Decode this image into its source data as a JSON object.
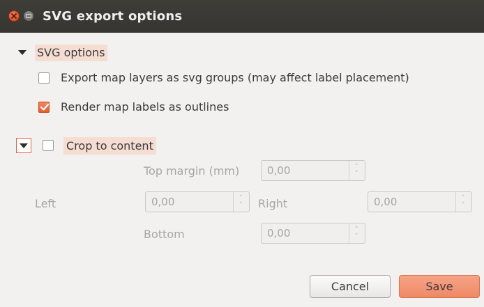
{
  "window": {
    "title": "SVG export options"
  },
  "svg_options": {
    "header": "SVG options",
    "export_layers_label": "Export map layers as svg groups (may affect label placement)",
    "export_layers_checked": false,
    "render_outlines_label": "Render map labels as outlines",
    "render_outlines_checked": true
  },
  "crop": {
    "label": "Crop to content",
    "checked": false,
    "top_margin_label": "Top margin (mm)",
    "top_value": "0,00",
    "left_label": "Left",
    "left_value": "0,00",
    "right_label": "Right",
    "right_value": "0,00",
    "bottom_label": "Bottom",
    "bottom_value": "0,00"
  },
  "buttons": {
    "cancel": "Cancel",
    "save": "Save"
  },
  "colors": {
    "accent": "#e25e2e",
    "highlight": "#f5ddd2",
    "titlebar": "#3c3b37"
  }
}
